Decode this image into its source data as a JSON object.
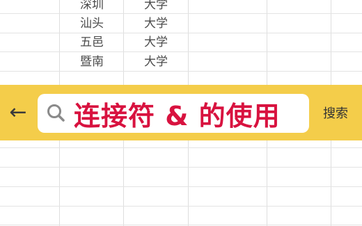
{
  "sheet": {
    "rows": [
      {
        "name": "深圳",
        "type": "大学"
      },
      {
        "name": "汕头",
        "type": "大学"
      },
      {
        "name": "五邑",
        "type": "大学"
      },
      {
        "name": "暨南",
        "type": "大学"
      }
    ]
  },
  "searchbar": {
    "back_icon": "arrow-left-icon",
    "search_icon": "magnifier-icon",
    "query": "连接符 & 的使用",
    "search_label": "搜索",
    "colors": {
      "bar": "#f4cd4a",
      "query_text": "#d8123f"
    }
  }
}
